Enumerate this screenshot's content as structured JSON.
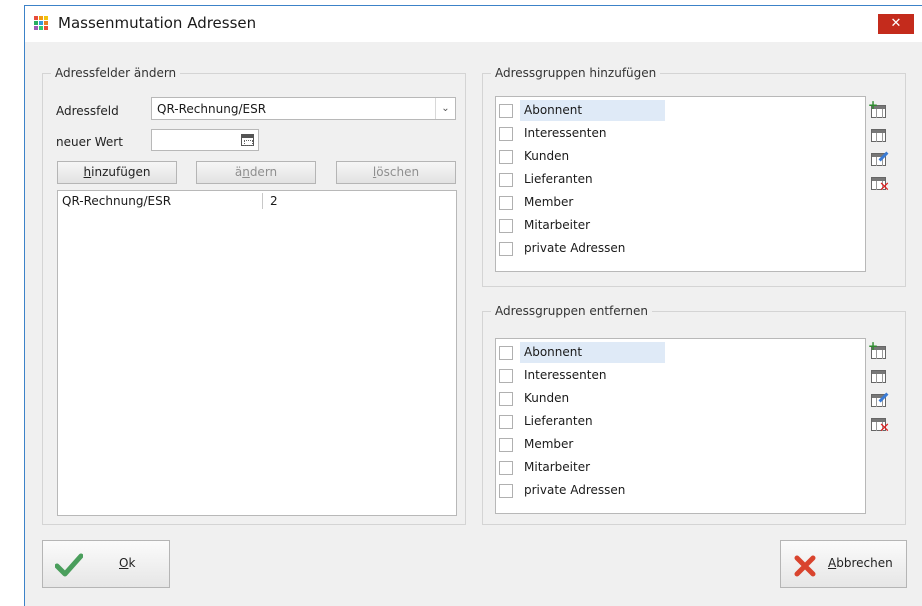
{
  "window": {
    "title": "Massenmutation Adressen",
    "close_glyph": "✕"
  },
  "left": {
    "legend": "Adressfelder ändern",
    "adressfeld_label": "Adressfeld",
    "adressfeld_value": "QR-Rechnung/ESR",
    "neuer_wert_label": "neuer Wert",
    "neuer_wert_value": "",
    "buttons": {
      "hinzufuegen": {
        "first": "h",
        "rest": "inzufügen"
      },
      "aendern": {
        "pre": "ä",
        "u": "n",
        "post": "dern"
      },
      "loeschen": {
        "u": "l",
        "post": "öschen"
      }
    },
    "rows": [
      {
        "field": "QR-Rechnung/ESR",
        "value": "2"
      }
    ]
  },
  "add_groups": {
    "legend": "Adressgruppen hinzufügen",
    "items": [
      "Abonnent",
      "Interessenten",
      "Kunden",
      "Lieferanten",
      "Member",
      "Mitarbeiter",
      "private Adressen"
    ]
  },
  "remove_groups": {
    "legend": "Adressgruppen entfernen",
    "items": [
      "Abonnent",
      "Interessenten",
      "Kunden",
      "Lieferanten",
      "Member",
      "Mitarbeiter",
      "private Adressen"
    ]
  },
  "footer": {
    "ok": {
      "u": "O",
      "rest": "k"
    },
    "cancel": {
      "u": "A",
      "rest": "bbrechen"
    }
  },
  "colors": {
    "accent": "#3c82c8",
    "close": "#c42b1c",
    "selection": "#dfeaf7",
    "ok_check": "#4a9e5c",
    "cancel_x": "#d9442e"
  },
  "icons": [
    "app-grid-icon",
    "close-icon",
    "chevron-down-icon",
    "calendar-icon",
    "table-add-icon",
    "table-icon",
    "table-edit-icon",
    "table-delete-icon",
    "checkmark-icon",
    "cancel-x-icon"
  ]
}
